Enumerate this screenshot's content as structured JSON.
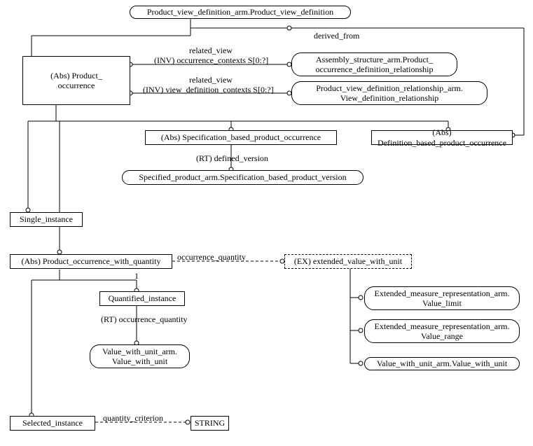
{
  "nodes": {
    "pvd": "Product_view_definition_arm.Product_view_definition",
    "po": "(Abs) Product_\noccurrence",
    "asm": "Assembly_structure_arm.Product_\noccurrence_definition_relationship",
    "pvdr": "Product_view_definition_relationship_arm.\nView_definition_relationship",
    "spec_po": "(Abs) Specification_based_product_occurrence",
    "def_po": "(Abs) Definition_based_product_occurrence",
    "spec_pv": "Specified_product_arm.Specification_based_product_version",
    "single": "Single_instance",
    "powq": "(Abs) Product_occurrence_with_quantity",
    "ext_vwu": "(EX) extended_value_with_unit",
    "qi": "Quantified_instance",
    "vwu": "Value_with_unit_arm.\nValue_with_unit",
    "val_limit": "Extended_measure_representation_arm.\nValue_limit",
    "val_range": "Extended_measure_representation_arm.\nValue_range",
    "vwu2": "Value_with_unit_arm.Value_with_unit",
    "sel_inst": "Selected_instance",
    "string": "STRING"
  },
  "labels": {
    "derived_from": "derived_from",
    "related_view1": "related_view",
    "inv_occ": "(INV) occurrence_contexts S[0:?]",
    "related_view2": "related_view",
    "inv_vd": "(INV) view_definition_contexts S[0:?]",
    "rt_dv": "(RT) defined_version",
    "occ_qty": "occurrence_quantity",
    "one": "1",
    "rt_oq": "(RT) occurrence_quantity",
    "qty_crit": "quantity_criterion"
  }
}
